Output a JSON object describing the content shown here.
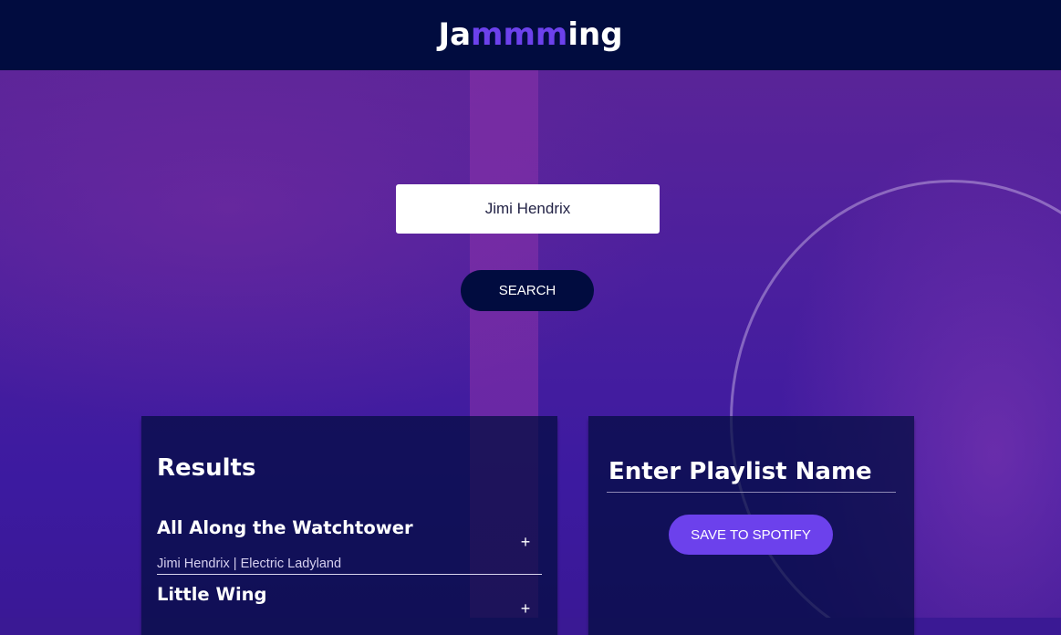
{
  "header": {
    "logo_prefix": "Ja",
    "logo_highlight": "mmm",
    "logo_suffix": "ing"
  },
  "search": {
    "value": "Jimi Hendrix",
    "button_label": "SEARCH"
  },
  "results": {
    "title": "Results",
    "tracks": [
      {
        "name": "All Along the Watchtower",
        "info": "Jimi Hendrix | Electric Ladyland",
        "action": "+"
      },
      {
        "name": "Little Wing",
        "info": "",
        "action": "+"
      }
    ]
  },
  "playlist": {
    "name": "Enter Playlist Name",
    "save_label": "SAVE TO SPOTIFY"
  },
  "colors": {
    "header_bg": "#010c3f",
    "accent": "#6c41ec",
    "panel_bg": "#010c3f"
  }
}
